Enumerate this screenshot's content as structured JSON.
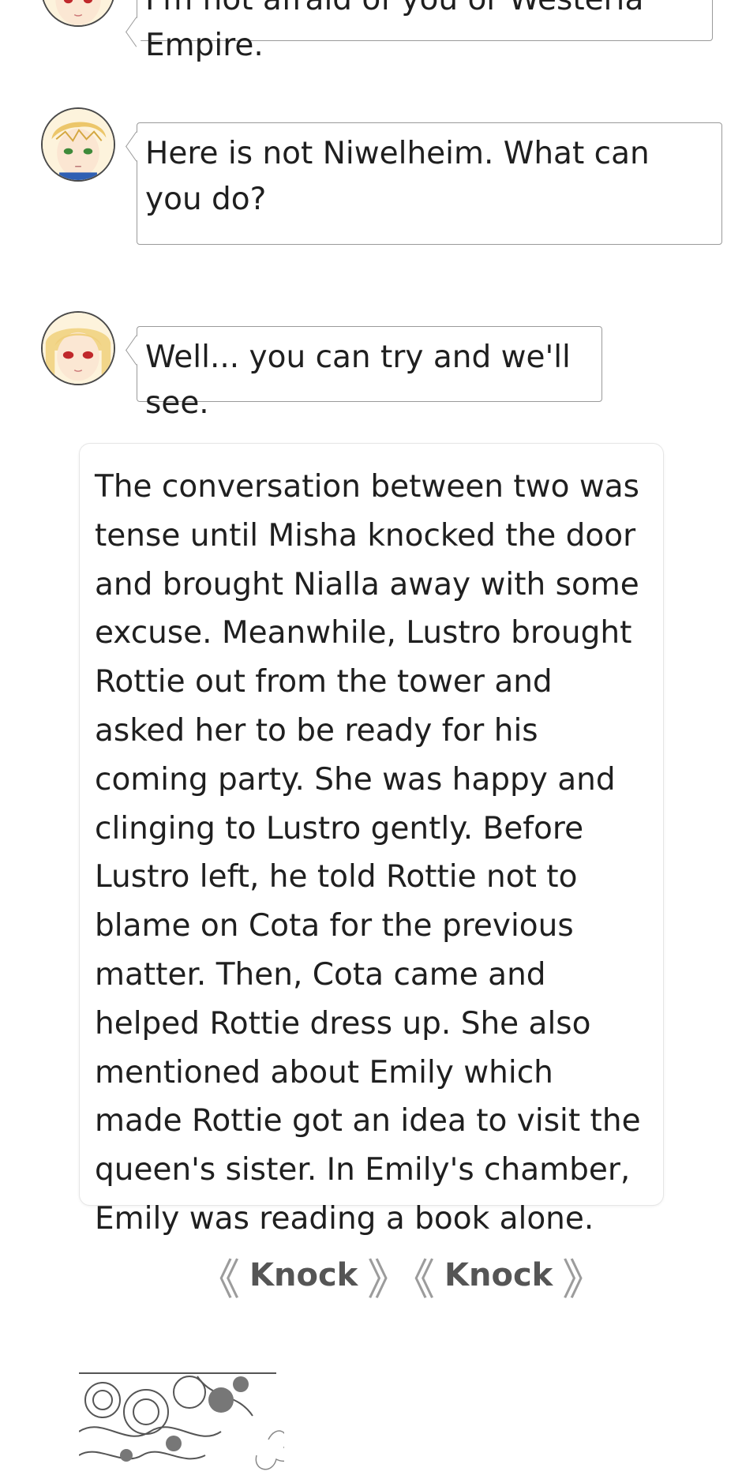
{
  "dialogue": [
    {
      "speaker_icon": "blonde-girl-red-eyes-avatar",
      "text": "I'm not afraid of you or Westeria Empire."
    },
    {
      "speaker_icon": "blonde-boy-green-eyes-avatar",
      "text": "Here is not Niwelheim. What can you do?"
    },
    {
      "speaker_icon": "blonde-girl-red-eyes-avatar",
      "text": "Well... you can try and we'll see."
    }
  ],
  "narration": {
    "text": "The conversation between two was tense until Misha knocked the door and brought Nialla away with some excuse. Meanwhile, Lustro brought Rottie out from the tower and asked her to be ready for his coming party. She was happy and clinging to Lustro gently. Before Lustro left, he told Rottie not to blame on Cota for the previous matter. Then, Cota came and helped Rottie dress up. She also mentioned about Emily which made Rottie got an idea to visit the queen's sister. In Emily's chamber, Emily was reading a book alone."
  },
  "choices": [
    {
      "open": "《",
      "label": "Knock",
      "close": "》"
    },
    {
      "open": "《",
      "label": "Knock",
      "close": "》"
    }
  ],
  "illustration": {
    "icon": "lace-and-flower-illustration"
  }
}
